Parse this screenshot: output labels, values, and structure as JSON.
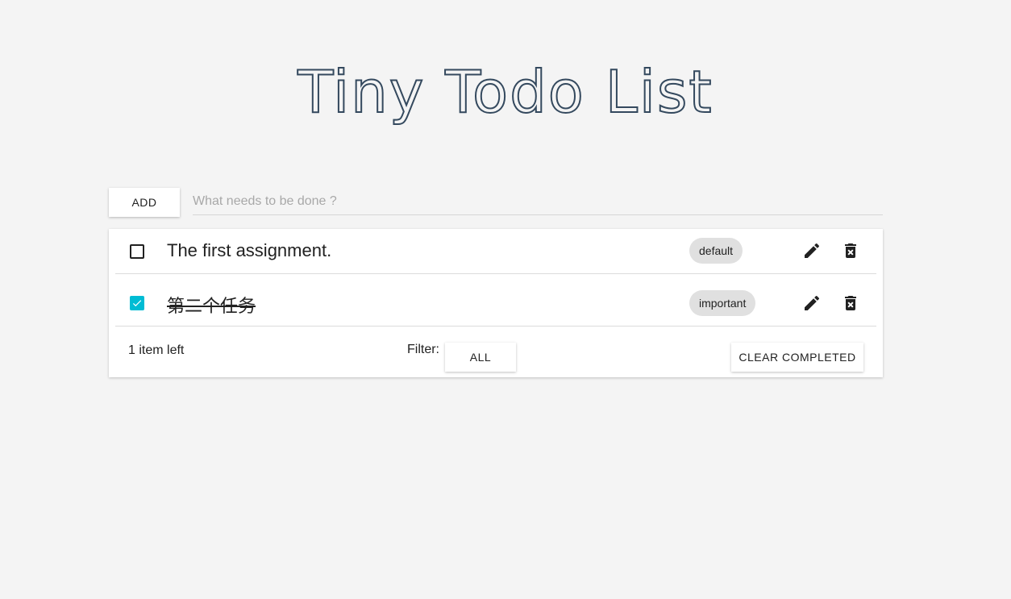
{
  "app": {
    "title": "Tiny Todo List"
  },
  "add_bar": {
    "add_label": "ADD",
    "input_placeholder": "What needs to be done ?",
    "input_value": ""
  },
  "todos": [
    {
      "text": "The first assignment.",
      "completed": false,
      "tag": "default",
      "edit_icon": "pencil-icon",
      "delete_icon": "trash-x-icon"
    },
    {
      "text": "第二个任务",
      "completed": true,
      "tag": "important",
      "edit_icon": "pencil-icon",
      "delete_icon": "trash-x-icon"
    }
  ],
  "footer": {
    "items_left": "1 item left",
    "filter_label": "Filter:",
    "filter_value": "ALL",
    "clear_label": "CLEAR COMPLETED"
  },
  "colors": {
    "background": "#f4f4f4",
    "title_stroke": "#34495e",
    "checkbox_checked": "#00bcd4",
    "tag_background": "#e0e0e0",
    "text": "#212121"
  }
}
